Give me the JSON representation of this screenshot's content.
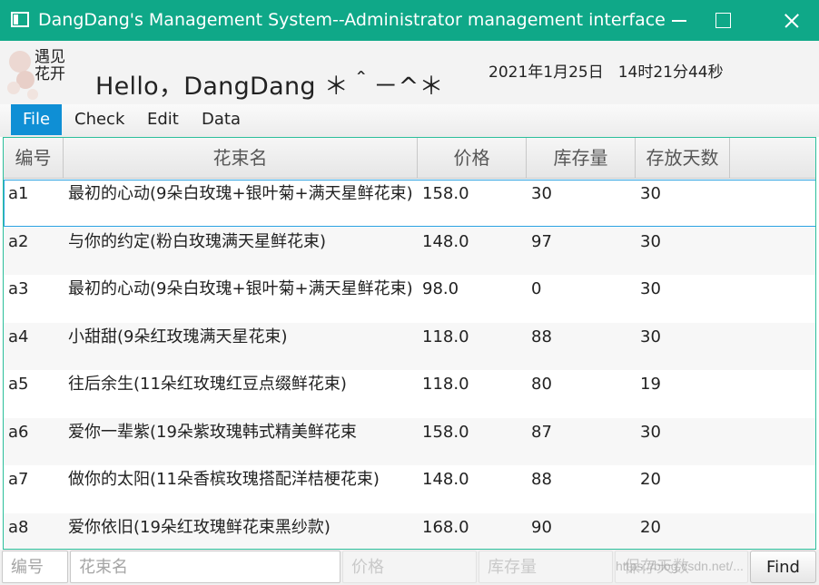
{
  "window": {
    "title": "DangDang's Management System--Administrator management interface",
    "accent_color": "#0fa888"
  },
  "header": {
    "logo_text": "遇见花开",
    "greeting": "Hello，DangDang ＊＾－^＊",
    "date": "2021年1月25日",
    "time": "14时21分44秒"
  },
  "menu": {
    "items": [
      {
        "label": "File",
        "active": true
      },
      {
        "label": "Check",
        "active": false
      },
      {
        "label": "Edit",
        "active": false
      },
      {
        "label": "Data",
        "active": false
      }
    ]
  },
  "table": {
    "columns": [
      "编号",
      "花束名",
      "价格",
      "库存量",
      "存放天数"
    ],
    "rows": [
      {
        "id": "a1",
        "name": "最初的心动(9朵白玫瑰+银叶菊+满天星鲜花束)",
        "price": "158.0",
        "stock": "30",
        "days": "30"
      },
      {
        "id": "a2",
        "name": "与你的约定(粉白玫瑰满天星鲜花束)",
        "price": "148.0",
        "stock": "97",
        "days": "30"
      },
      {
        "id": "a3",
        "name": "最初的心动(9朵白玫瑰+银叶菊+满天星鲜花束)",
        "price": "98.0",
        "stock": "0",
        "days": "30"
      },
      {
        "id": "a4",
        "name": "小甜甜(9朵红玫瑰满天星花束)",
        "price": "118.0",
        "stock": "88",
        "days": "30"
      },
      {
        "id": "a5",
        "name": "往后余生(11朵红玫瑰红豆点缀鲜花束)",
        "price": "118.0",
        "stock": "80",
        "days": "19"
      },
      {
        "id": "a6",
        "name": "爱你一辈紫(19朵紫玫瑰韩式精美鲜花束",
        "price": "158.0",
        "stock": "87",
        "days": "30"
      },
      {
        "id": "a7",
        "name": "做你的太阳(11朵香槟玫瑰搭配洋桔梗花束)",
        "price": "148.0",
        "stock": "88",
        "days": "20"
      },
      {
        "id": "a8",
        "name": "爱你依旧(19朵红玫瑰鲜花束黑纱款)",
        "price": "168.0",
        "stock": "90",
        "days": "20"
      }
    ]
  },
  "inputs": {
    "id_placeholder": "编号",
    "name_placeholder": "花束名",
    "price_placeholder": "价格",
    "stock_placeholder": "库存量",
    "days_placeholder": "保存天数",
    "find_label": "Find"
  },
  "watermark": "https://blog.csdn.net/..."
}
